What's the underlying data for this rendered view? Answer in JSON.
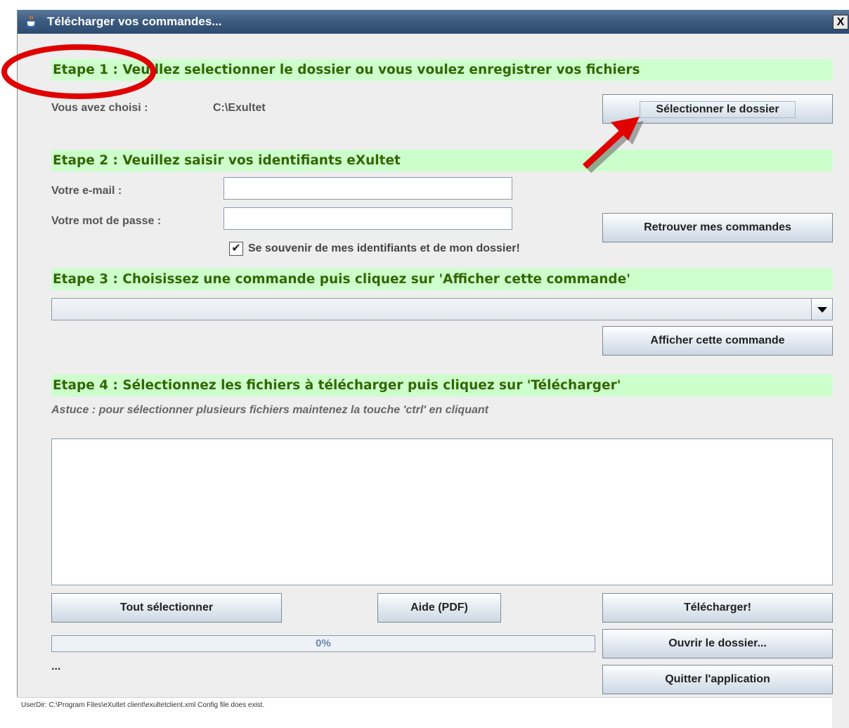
{
  "window": {
    "title": "Télécharger vos commandes...",
    "close_label": "X"
  },
  "step1": {
    "header": "Etape 1 : Veuillez selectionner le dossier ou vous voulez enregistrer vos fichiers",
    "chosen_label": "Vous avez choisi :",
    "chosen_value": "C:\\Exultet",
    "select_folder_button": "Sélectionner le dossier"
  },
  "step2": {
    "header": "Etape 2 : Veuillez saisir vos identifiants eXultet",
    "email_label": "Votre e-mail :",
    "email_value": "",
    "password_label": "Votre mot de passe :",
    "password_value": "",
    "remember_label": "Se souvenir de mes identifiants et de mon dossier!",
    "remember_checked": true,
    "find_orders_button": "Retrouver mes commandes"
  },
  "step3": {
    "header": "Etape 3 : Choisissez une commande puis cliquez sur 'Afficher cette commande'",
    "selected_order": "",
    "show_order_button": "Afficher cette commande"
  },
  "step4": {
    "header": "Etape 4 : Sélectionnez les fichiers à télécharger puis cliquez sur 'Télécharger'",
    "hint": "Astuce : pour sélectionner plusieurs fichiers maintenez la touche 'ctrl' en cliquant",
    "select_all_button": "Tout sélectionner",
    "help_button": "Aide (PDF)",
    "download_button": "Télécharger!",
    "open_folder_button": "Ouvrir le dossier...",
    "quit_button": "Quitter l'application",
    "progress_text": "0%",
    "progress_value": 0,
    "status_ellipsis": "..."
  },
  "statusbar": {
    "line1": "UserDir: C:\\Program Files\\eXultet client\\exultetclient.xml Config file does exist.",
    "line2": ""
  },
  "colors": {
    "step_header_bg": "#ccffcc",
    "step_header_text": "#336600",
    "annotation_red": "#e00000"
  },
  "icons": {
    "app": "java-coffee-icon",
    "close": "close-icon",
    "combo_arrow": "chevron-down-icon",
    "check": "checkmark-icon"
  }
}
